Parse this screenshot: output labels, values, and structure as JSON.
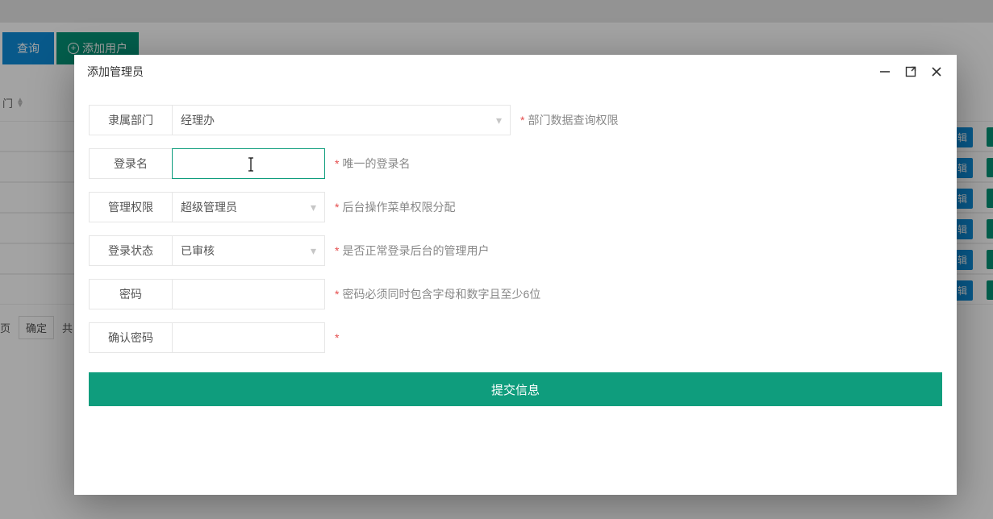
{
  "bg": {
    "query_label": "查询",
    "add_user_label": "添加用户",
    "col_header": "门",
    "page_label": "页",
    "ok_label": "确定",
    "total_label": "共",
    "edit_label": "辑"
  },
  "modal": {
    "title": "添加管理员",
    "rows": {
      "dept_label": "隶属部门",
      "dept_value": "经理办",
      "dept_help": "部门数据查询权限",
      "login_label": "登录名",
      "login_value": "",
      "login_help": "唯一的登录名",
      "perm_label": "管理权限",
      "perm_value": "超级管理员",
      "perm_help": "后台操作菜单权限分配",
      "status_label": "登录状态",
      "status_value": "已审核",
      "status_help": "是否正常登录后台的管理用户",
      "pwd_label": "密码",
      "pwd_value": "",
      "pwd_help": "密码必须同时包含字母和数字且至少6位",
      "pwd2_label": "确认密码",
      "pwd2_value": "",
      "pwd2_help": ""
    },
    "submit_label": "提交信息"
  }
}
